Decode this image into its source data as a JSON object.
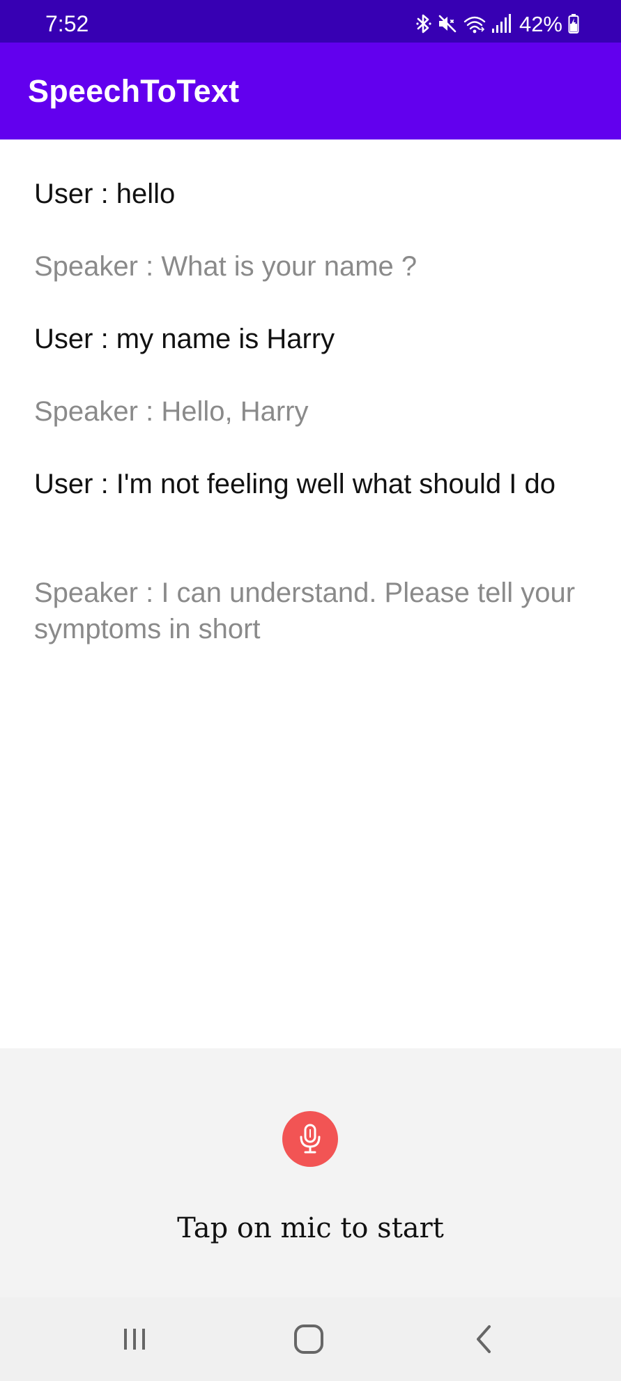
{
  "status_bar": {
    "time": "7:52",
    "battery": "42%",
    "icons": [
      "bluetooth-icon",
      "mute-icon",
      "wifi-icon",
      "signal-icon",
      "battery-icon"
    ]
  },
  "app_bar": {
    "title": "SpeechToText"
  },
  "conversation": {
    "messages": [
      {
        "role": "user",
        "text": "User : hello"
      },
      {
        "role": "speaker",
        "text": "Speaker : What is your name ?"
      },
      {
        "role": "user",
        "text": "User : my name is Harry"
      },
      {
        "role": "speaker",
        "text": "Speaker : Hello, Harry"
      },
      {
        "role": "user",
        "text": "User : I'm not feeling well what should I do"
      },
      {
        "role": "speaker",
        "text": "Speaker : I can understand. Please tell your symptoms in short"
      }
    ]
  },
  "controls": {
    "mic_icon": "microphone-icon",
    "hint": "Tap on mic to start"
  },
  "navigation": {
    "icons": [
      "recent-apps-icon",
      "home-icon",
      "back-icon"
    ]
  },
  "colors": {
    "status_bar": "#3700b3",
    "app_bar": "#6200ee",
    "mic_button": "#f25454",
    "user_text": "#111111",
    "speaker_text": "#8a8a8a",
    "panel": "#f3f3f3"
  }
}
